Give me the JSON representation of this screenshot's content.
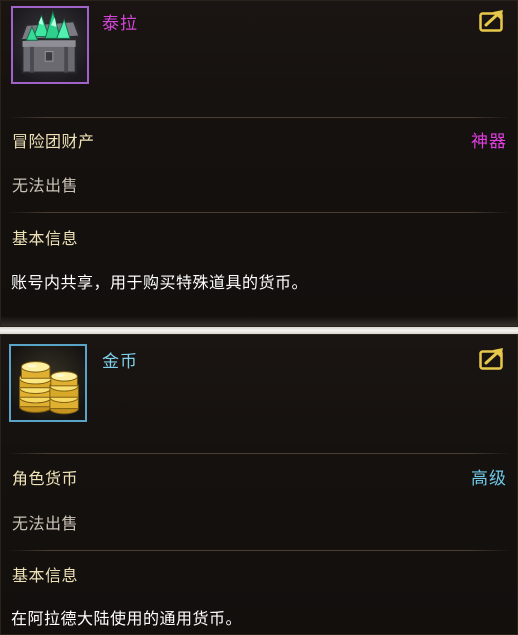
{
  "items": [
    {
      "name": "泰拉",
      "icon": "tera-chest-icon",
      "category": "冒险团财产",
      "rarity": "神器",
      "trade": "无法出售",
      "section_title": "基本信息",
      "description": "账号内共享，用于购买特殊道具的货币。",
      "name_color": "#d246d8",
      "rarity_color": "#e03fe0"
    },
    {
      "name": "金币",
      "icon": "gold-coins-icon",
      "category": "角色货币",
      "rarity": "高级",
      "trade": "无法出售",
      "section_title": "基本信息",
      "description": "在阿拉德大陆使用的通用货币。",
      "name_color": "#7fd0e8",
      "rarity_color": "#6ec8e6"
    }
  ],
  "export_icon": "export-icon"
}
